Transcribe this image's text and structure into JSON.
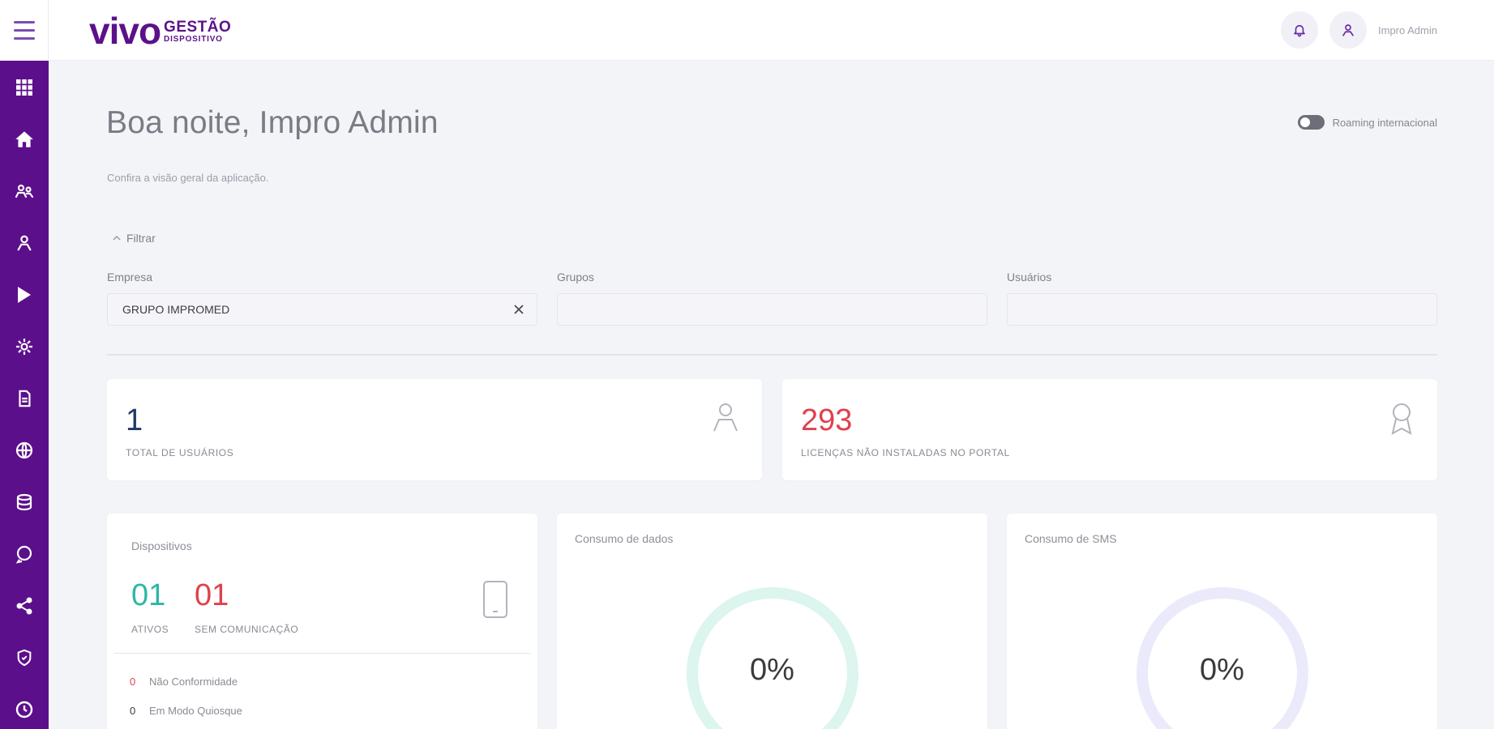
{
  "brand": {
    "logo_main": "vivo",
    "logo_line1": "GESTÃO",
    "logo_line2": "DISPOSITIVO",
    "accent": "#5c0f8b"
  },
  "header": {
    "user_name": "Impro Admin",
    "icons": [
      "bell-icon",
      "user-icon"
    ]
  },
  "sidebar": {
    "items": [
      {
        "name": "apps-grid-icon"
      },
      {
        "name": "home-icon"
      },
      {
        "name": "users-group-icon"
      },
      {
        "name": "user-icon"
      },
      {
        "name": "play-store-icon"
      },
      {
        "name": "settings-icon"
      },
      {
        "name": "document-icon"
      },
      {
        "name": "globe-icon"
      },
      {
        "name": "database-icon"
      },
      {
        "name": "chat-icon"
      },
      {
        "name": "share-icon"
      },
      {
        "name": "shield-icon"
      },
      {
        "name": "clock-icon"
      }
    ]
  },
  "page": {
    "greeting": "Boa noite, Impro Admin",
    "subtitle": "Confira a visão geral da aplicação.",
    "roaming_label": "Roaming internacional"
  },
  "filter": {
    "toggle_label": "Filtrar",
    "company_label": "Empresa",
    "company_value": "GRUPO IMPROMED",
    "groups_label": "Grupos",
    "groups_value": "",
    "users_label": "Usuários",
    "users_value": ""
  },
  "stats": {
    "total_users": {
      "value": "1",
      "label": "TOTAL DE USUÁRIOS",
      "color": "#1e3a66"
    },
    "licenses": {
      "value": "293",
      "label": "LICENÇAS NÃO INSTALADAS NO PORTAL",
      "color": "#e0404e"
    }
  },
  "devices": {
    "title": "Dispositivos",
    "active_value": "01",
    "active_label": "ATIVOS",
    "active_color": "#2fb6a6",
    "no_comm_value": "01",
    "no_comm_label": "SEM COMUNICAÇÃO",
    "no_comm_color": "#e0404e",
    "rows": [
      {
        "count": "0",
        "label": "Não Conformidade",
        "color": "#e0404e"
      },
      {
        "count": "0",
        "label": "Em Modo Quiosque",
        "color": "#3a3a3a"
      }
    ]
  },
  "data_usage": {
    "title": "Consumo de dados",
    "percent": "0%",
    "ring_color": "#dcf5ee"
  },
  "sms_usage": {
    "title": "Consumo de SMS",
    "percent": "0%",
    "ring_color": "#ebeafb"
  }
}
